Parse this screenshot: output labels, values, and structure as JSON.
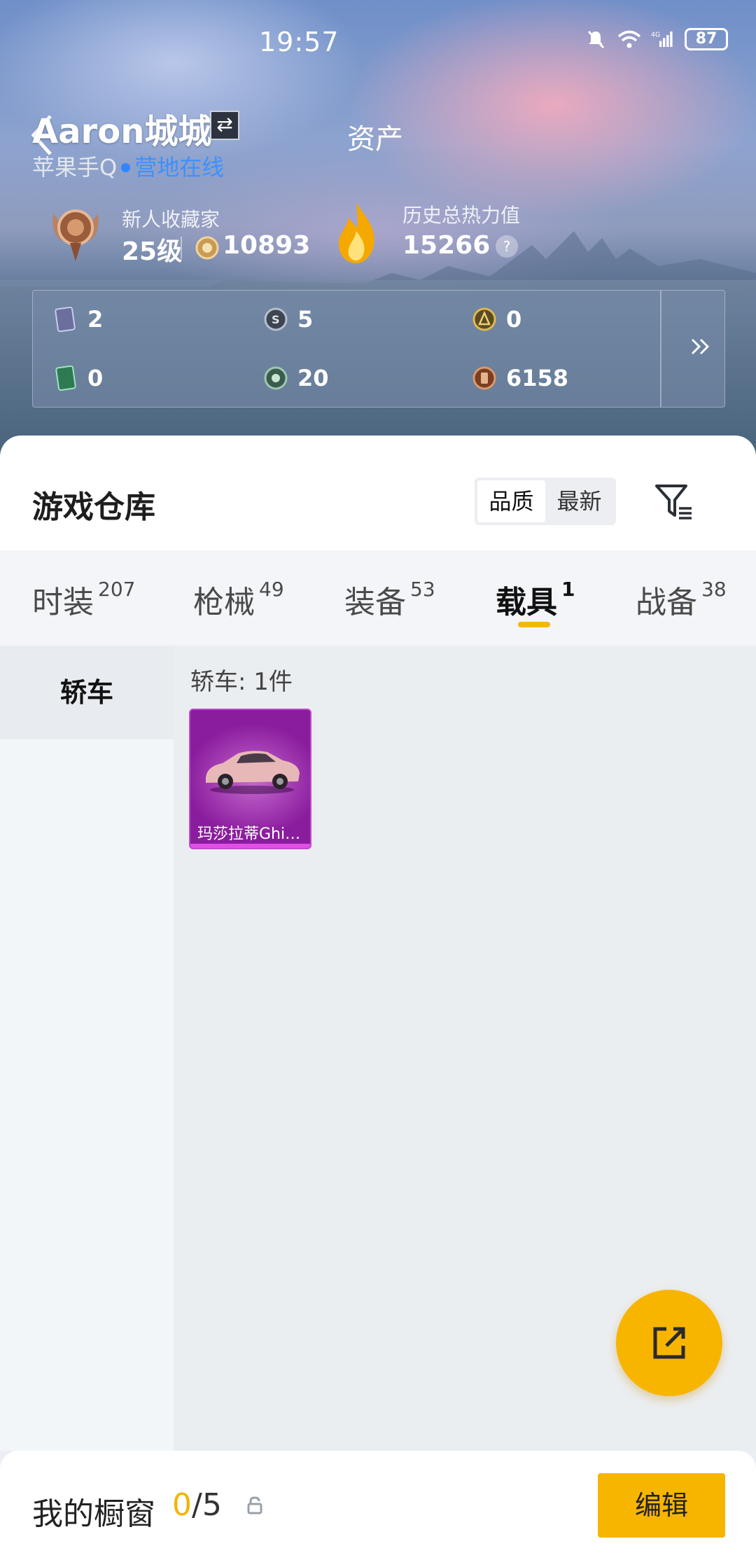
{
  "status_bar": {
    "time": "19:57",
    "battery": "87",
    "icons": [
      "bell-off-icon",
      "wifi-icon",
      "signal-4g-icon",
      "battery-icon"
    ]
  },
  "header": {
    "title": "资产",
    "username": "Aaron城城",
    "platform": "苹果手Q",
    "online_status": "营地在线",
    "collector_label": "新人收藏家",
    "level": "25级",
    "collector_points": "10893",
    "heat_label": "历史总热力值",
    "heat_value": "15266",
    "help": "?"
  },
  "currencies": [
    {
      "icon": "card-icon",
      "value": "2"
    },
    {
      "icon": "silver-coin-icon",
      "value": "5"
    },
    {
      "icon": "gold-token-icon",
      "value": "0"
    },
    {
      "icon": "green-card-icon",
      "value": "0"
    },
    {
      "icon": "gem-coin-icon",
      "value": "20"
    },
    {
      "icon": "bronze-token-icon",
      "value": "6158"
    }
  ],
  "warehouse": {
    "title": "游戏仓库",
    "sort_options": [
      "品质",
      "最新"
    ],
    "active_sort": "品质"
  },
  "tabs": [
    {
      "label": "时装",
      "count": "207"
    },
    {
      "label": "枪械",
      "count": "49"
    },
    {
      "label": "装备",
      "count": "53"
    },
    {
      "label": "载具",
      "count": "1",
      "active": true
    },
    {
      "label": "战备",
      "count": "38"
    }
  ],
  "sidebar": {
    "items": [
      {
        "label": "轿车",
        "active": true
      }
    ]
  },
  "content": {
    "group_title": "轿车: 1件",
    "items": [
      {
        "name": "玛莎拉蒂Ghi…",
        "rarity_color": "#b43bc4"
      }
    ]
  },
  "bottom_bar": {
    "showcase_label": "我的橱窗",
    "showcase_current": "0",
    "showcase_total": "/5",
    "edit_label": "编辑"
  },
  "colors": {
    "accent": "#f7b500",
    "online": "#3e90ff",
    "rarity_purple": "#b43bc4"
  }
}
